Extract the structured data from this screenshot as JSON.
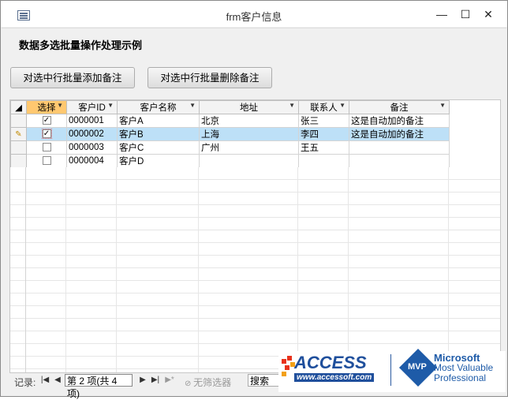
{
  "window": {
    "title": "frm客户信息",
    "minimize": "—",
    "maximize": "☐",
    "close": "✕"
  },
  "form": {
    "title": "数据多选批量操作处理示例",
    "btn_add": "对选中行批量添加备注",
    "btn_delete": "对选中行批量删除备注"
  },
  "grid": {
    "columns": [
      "选择",
      "客户ID",
      "客户名称",
      "地址",
      "联系人",
      "备注"
    ],
    "rows": [
      {
        "selected": true,
        "id": "0000001",
        "name": "客户A",
        "address": "北京",
        "contact": "张三",
        "note": "这是自动加的备注"
      },
      {
        "selected": true,
        "id": "0000002",
        "name": "客户B",
        "address": "上海",
        "contact": "李四",
        "note": "这是自动加的备注"
      },
      {
        "selected": false,
        "id": "0000003",
        "name": "客户C",
        "address": "广州",
        "contact": "王五",
        "note": ""
      },
      {
        "selected": false,
        "id": "0000004",
        "name": "客户D",
        "address": "",
        "contact": "",
        "note": ""
      }
    ]
  },
  "nav": {
    "label": "记录:",
    "first": "|◀",
    "prev": "◀",
    "current": "第 2 项(共 4 项)",
    "next": "▶",
    "last": "▶|",
    "new": "▶*",
    "no_filter": "无筛选器",
    "search": "搜索"
  },
  "logos": {
    "access": "ACCESS",
    "access_url": "www.accessoft.com",
    "mvp_badge": "MVP",
    "mvp_line1": "Microsoft",
    "mvp_line2": "Most Valuable",
    "mvp_line3": "Professional"
  },
  "colors": {
    "current_row": "#bde0f7",
    "selected_header": "#ffc870",
    "brand_blue": "#1e5ba8"
  }
}
